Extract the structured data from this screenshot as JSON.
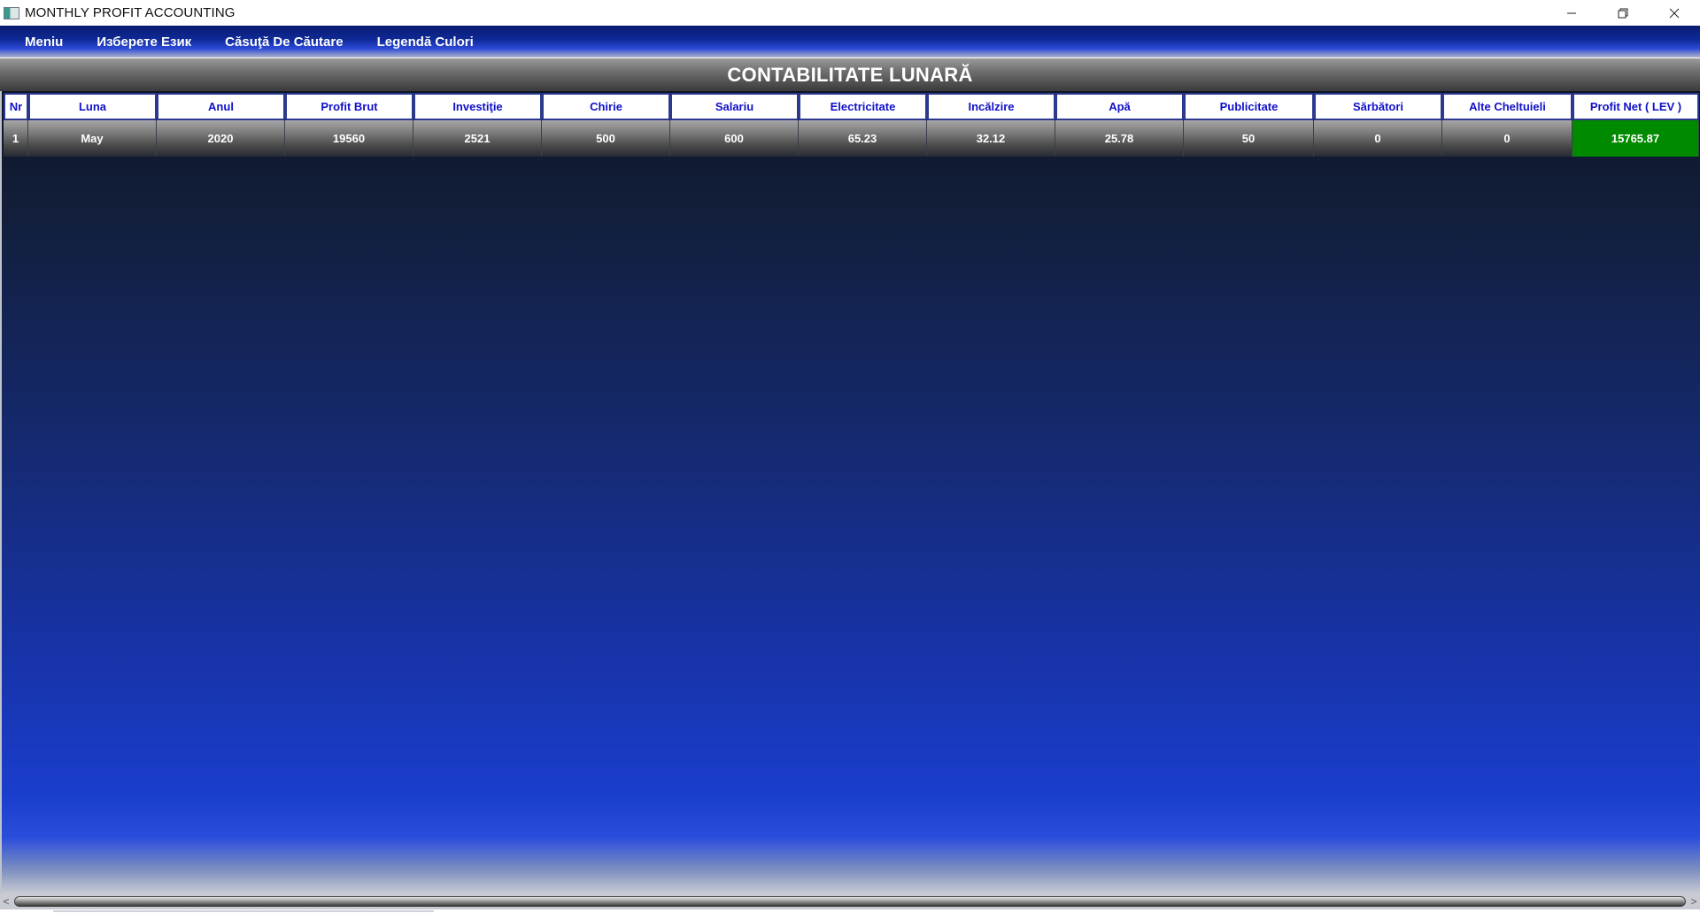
{
  "window": {
    "title": "MONTHLY PROFIT ACCOUNTING",
    "minimize_icon": "minimize-icon",
    "restore_icon": "restore-icon",
    "close_icon": "close-icon"
  },
  "menu": {
    "items": [
      {
        "label": "Meniu"
      },
      {
        "label": "Изберете Език"
      },
      {
        "label": "Căsuţă De Căutare"
      },
      {
        "label": "Legendă Culori"
      }
    ]
  },
  "heading": "CONTABILITATE LUNARĂ",
  "table": {
    "columns": [
      "Nr",
      "Luna",
      "Anul",
      "Profit Brut",
      "Investiţie",
      "Chirie",
      "Salariu",
      "Electricitate",
      "Incălzire",
      "Apă",
      "Publicitate",
      "Sărbători",
      "Alte Cheltuieli",
      "Profit Net ( LEV )"
    ],
    "rows": [
      [
        "1",
        "May",
        "2020",
        "19560",
        "2521",
        "500",
        "600",
        "65.23",
        "32.12",
        "25.78",
        "50",
        "0",
        "0",
        "15765.87"
      ]
    ]
  },
  "colors": {
    "header_text": "#1010c8",
    "profit_positive": "#008a00",
    "menu_bar": "#0f2a9a"
  },
  "scrollbar": {
    "left_arrow": "<",
    "right_arrow": ">"
  }
}
